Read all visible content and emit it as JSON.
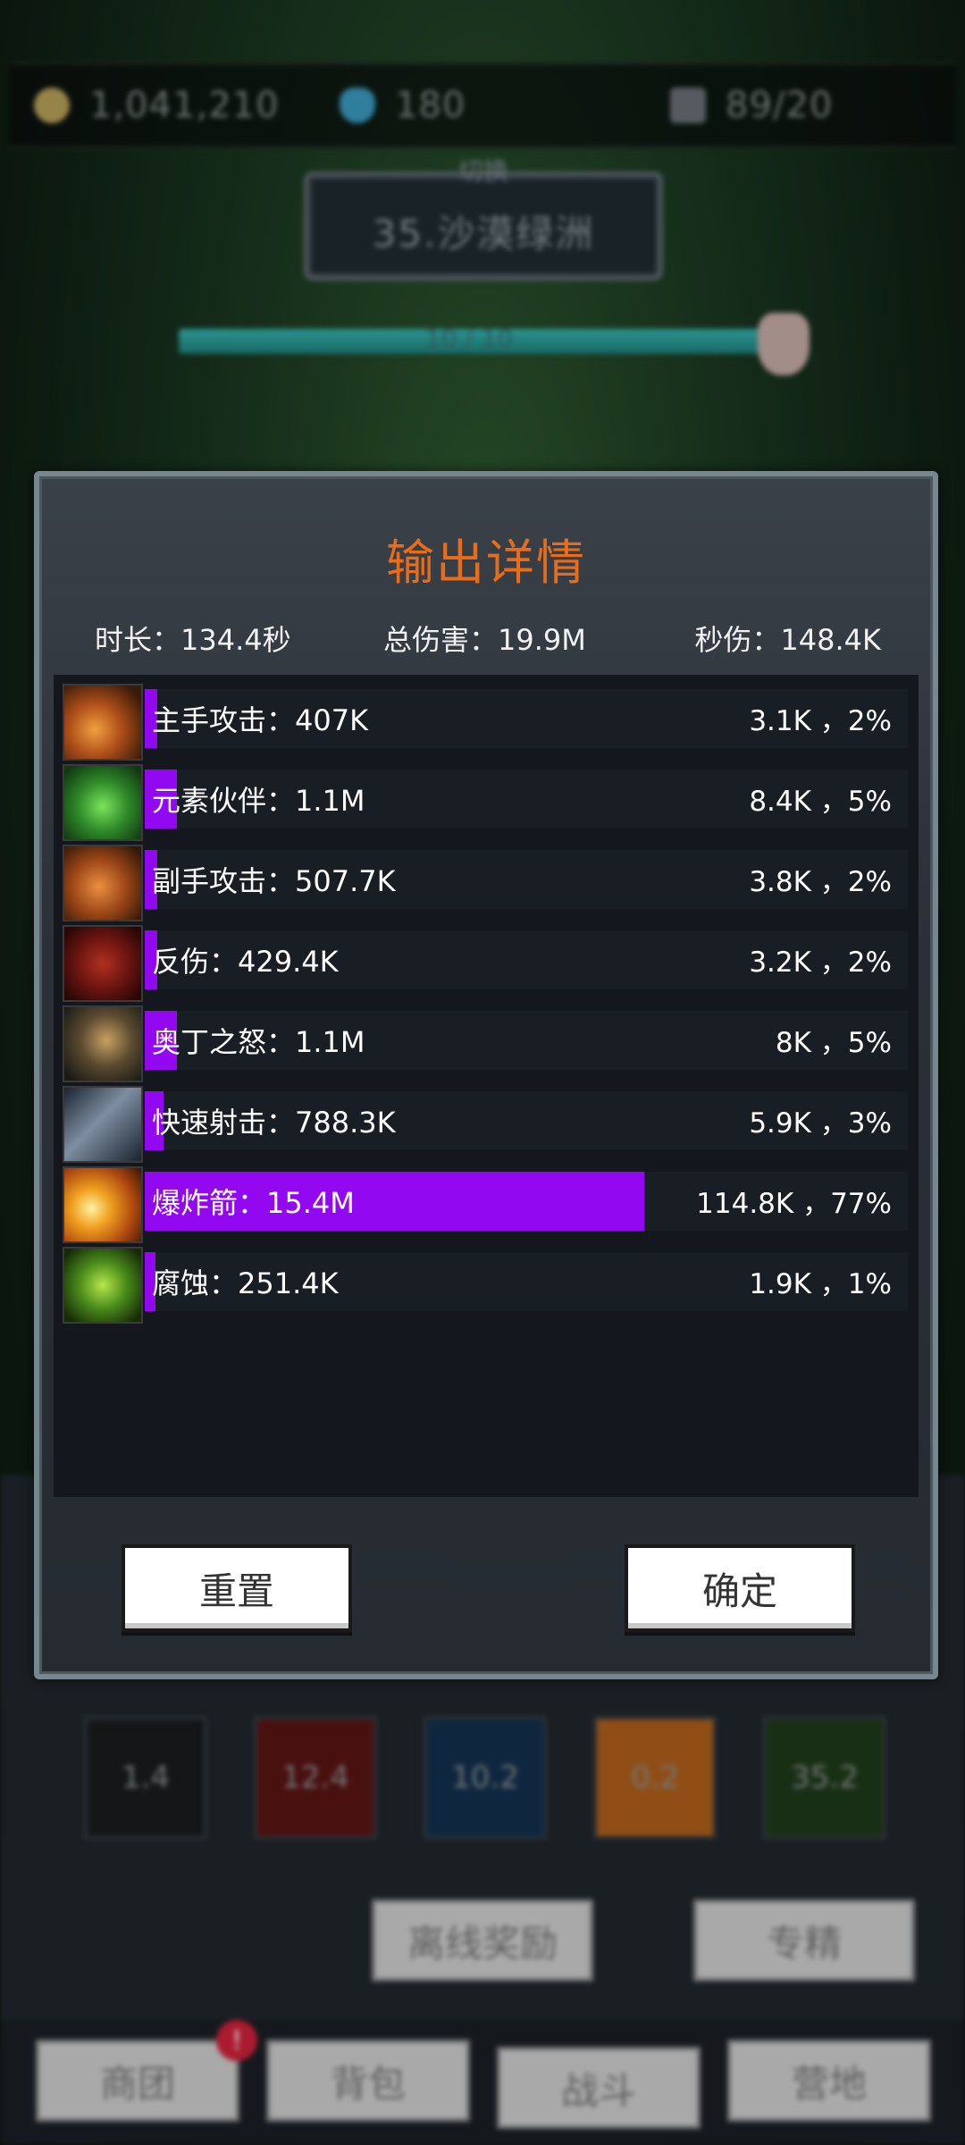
{
  "resources": {
    "gold": "1,041,210",
    "gems": "180",
    "stamina": "89/20"
  },
  "stage": {
    "switch_label": "切换",
    "name": "35.沙漠绿洲",
    "progress_text": "10 / 10",
    "progress_fraction": 1.0
  },
  "dialog": {
    "title": "输出详情",
    "duration_label": "时长：",
    "duration_value": "134.4秒",
    "total_label": "总伤害：",
    "total_value": "19.9M",
    "dps_label": "秒伤：",
    "dps_value": "148.4K",
    "rows": [
      {
        "name": "主手攻击：407K",
        "right": "3.1K ，2%",
        "fraction": 0.02,
        "icon": "sword-icon"
      },
      {
        "name": "元素伙伴：1.1M",
        "right": "8.4K ，5%",
        "fraction": 0.05,
        "icon": "paw-icon"
      },
      {
        "name": "副手攻击：507.7K",
        "right": "3.8K ，2%",
        "fraction": 0.02,
        "icon": "offhand-sword-icon"
      },
      {
        "name": "反伤：429.4K",
        "right": "3.2K ，2%",
        "fraction": 0.02,
        "icon": "thorns-icon"
      },
      {
        "name": "奥丁之怒：1.1M",
        "right": "8K ，5%",
        "fraction": 0.05,
        "icon": "hammer-icon"
      },
      {
        "name": "快速射击：788.3K",
        "right": "5.9K ，3%",
        "fraction": 0.03,
        "icon": "arrowhead-icon"
      },
      {
        "name": "爆炸箭：15.4M",
        "right": "114.8K ，77%",
        "fraction": 0.77,
        "icon": "explosive-arrow-icon"
      },
      {
        "name": "腐蚀：251.4K",
        "right": "1.9K ，1%",
        "fraction": 0.01,
        "icon": "skull-icon"
      }
    ],
    "reset_label": "重置",
    "ok_label": "确定"
  },
  "skills": [
    "1.4",
    "12.4",
    "10.2",
    "0.2",
    "35.2"
  ],
  "buttons": {
    "offline_reward": "离线奖励",
    "mastery": "专精"
  },
  "nav": {
    "items": [
      "商团",
      "背包",
      "战斗",
      "营地"
    ],
    "badge": "!"
  },
  "colors": {
    "title": "#e86d1a",
    "bar": "#9208f0"
  }
}
